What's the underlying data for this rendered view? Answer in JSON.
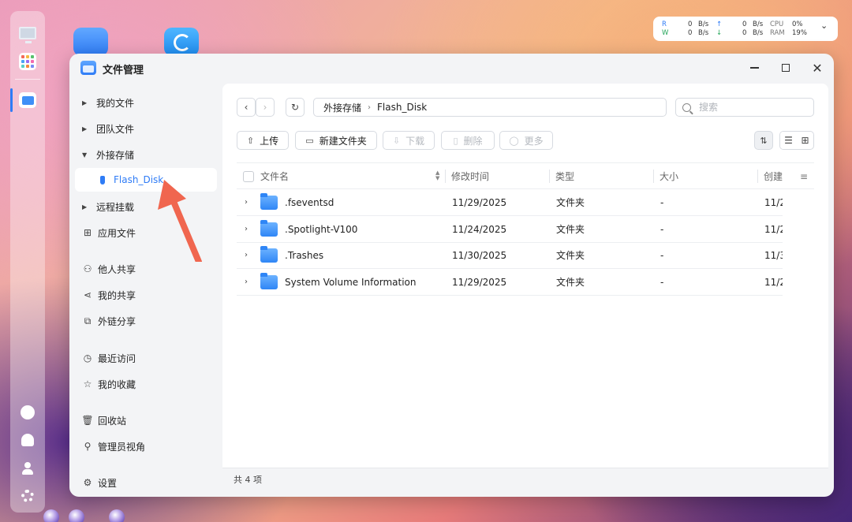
{
  "window": {
    "title": "文件管理"
  },
  "sysmon": {
    "r_label": "R",
    "w_label": "W",
    "r_down": "0",
    "w_down": "0",
    "r_up": "0",
    "w_up": "0",
    "unit": "B/s",
    "up_arrow": "↑",
    "down_arrow": "↓",
    "cpu_label": "CPU",
    "ram_label": "RAM",
    "cpu_value": "0%",
    "ram_value": "19%"
  },
  "sidebar": {
    "items": [
      {
        "label": "我的文件"
      },
      {
        "label": "团队文件"
      },
      {
        "label": "外接存储"
      },
      {
        "label": "Flash_Disk"
      },
      {
        "label": "远程挂载"
      },
      {
        "label": "应用文件"
      },
      {
        "label": "他人共享"
      },
      {
        "label": "我的共享"
      },
      {
        "label": "外链分享"
      },
      {
        "label": "最近访问"
      },
      {
        "label": "我的收藏"
      },
      {
        "label": "回收站"
      },
      {
        "label": "管理员视角"
      },
      {
        "label": "设置"
      }
    ]
  },
  "path": {
    "segments": [
      "外接存储",
      "Flash_Disk"
    ]
  },
  "search": {
    "placeholder": "搜索"
  },
  "toolbar": {
    "upload": "上传",
    "new_folder": "新建文件夹",
    "download": "下载",
    "delete": "删除",
    "more": "更多"
  },
  "table": {
    "columns": [
      "文件名",
      "修改时间",
      "类型",
      "大小",
      "创建"
    ],
    "rows": [
      {
        "name": ".fseventsd",
        "modified": "11/29/2025",
        "type": "文件夹",
        "size": "-",
        "created": "11/2"
      },
      {
        "name": ".Spotlight-V100",
        "modified": "11/24/2025",
        "type": "文件夹",
        "size": "-",
        "created": "11/2"
      },
      {
        "name": ".Trashes",
        "modified": "11/30/2025",
        "type": "文件夹",
        "size": "-",
        "created": "11/3"
      },
      {
        "name": "System Volume Information",
        "modified": "11/29/2025",
        "type": "文件夹",
        "size": "-",
        "created": "11/2"
      }
    ]
  },
  "status": {
    "count_text": "共 4 项"
  },
  "colors": {
    "accent": "#2f7cf6",
    "annotation_arrow": "#f0664f"
  }
}
